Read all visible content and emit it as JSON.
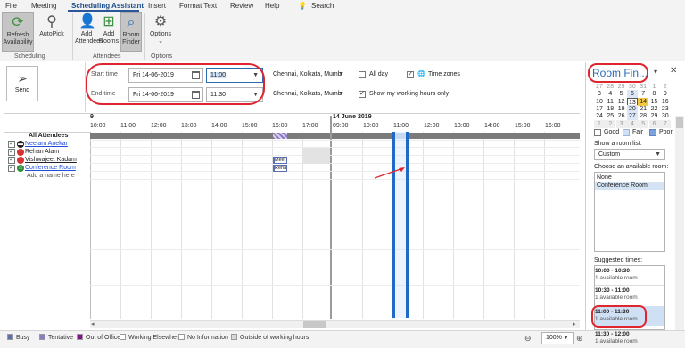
{
  "menu": [
    "File",
    "Meeting",
    "Scheduling Assistant",
    "Insert",
    "Format Text",
    "Review",
    "Help",
    "Search"
  ],
  "ribbon": {
    "refresh": "Refresh Availability",
    "refresh_l1": "Refresh",
    "refresh_l2": "Availability",
    "autopick": "AutoPick",
    "group_scheduling": "Scheduling",
    "add_att_l1": "Add",
    "add_att_l2": "Attendees",
    "add_rooms_l1": "Add",
    "add_rooms_l2": "Rooms",
    "room_finder_l1": "Room",
    "room_finder_l2": "Finder",
    "group_attendees": "Attendees",
    "options": "Options",
    "group_options": "Options"
  },
  "send": "Send",
  "start": {
    "label": "Start time",
    "date": "Fri 14-06-2019",
    "time": "11:00"
  },
  "end": {
    "label": "End time",
    "date": "Fri 14-06-2019",
    "time": "11:30"
  },
  "timezone": "Chennai, Kolkata, Mumb",
  "all_day": "All day",
  "time_zones": "Time zones",
  "show_working": "Show my working hours only",
  "grid": {
    "day1_label": "9",
    "day2_label": "14 June 2019",
    "hours1": [
      "10:00",
      "11:00",
      "12:00",
      "13:00",
      "14:00",
      "15:00",
      "16:00",
      "17:00"
    ],
    "hours2": [
      "09:00",
      "10:00",
      "11:00",
      "12:00",
      "13:00",
      "14:00",
      "15:00",
      "16:00"
    ],
    "all_attendees": "All Attendees",
    "attendees": [
      {
        "name": "Neelam Anekar",
        "link": false
      },
      {
        "name": "Rehan Alam",
        "link": false
      },
      {
        "name": "Vishwajeet Kadam",
        "link": false
      },
      {
        "name": "Conference Room",
        "link": true
      }
    ],
    "add_name": "Add a name here",
    "meet1": "Meet",
    "meet2": "Reha"
  },
  "legend": [
    "Busy",
    "Tentative",
    "Out of Office",
    "Working Elsewhere",
    "No Information",
    "Outside of working hours"
  ],
  "legend_colors": [
    "#5b6fb0",
    "#8e7cc3",
    "#8b0f8b",
    "#ffffff",
    "#ffffff",
    "#d7d7d7"
  ],
  "zoom": "100%",
  "room_finder": {
    "title": "Room Fin...",
    "cal_rows": [
      [
        "27",
        "28",
        "29",
        "30",
        "31",
        "1",
        "2"
      ],
      [
        "3",
        "4",
        "5",
        "6",
        "7",
        "8",
        "9"
      ],
      [
        "10",
        "11",
        "12",
        "13",
        "14",
        "15",
        "16"
      ],
      [
        "17",
        "18",
        "19",
        "20",
        "21",
        "22",
        "23"
      ],
      [
        "24",
        "25",
        "26",
        "27",
        "28",
        "29",
        "30"
      ],
      [
        "1",
        "2",
        "3",
        "4",
        "5",
        "6",
        "7"
      ]
    ],
    "good": "Good",
    "fair": "Fair",
    "poor": "Poor",
    "show_room_list": "Show a room list:",
    "room_list_value": "Custom",
    "choose_room": "Choose an available room:",
    "rooms": [
      "None",
      "Conference Room"
    ],
    "suggested": "Suggested times:",
    "suggestions": [
      {
        "time": "10:00 - 10:30",
        "count": "1 available room"
      },
      {
        "time": "10:30 - 11:00",
        "count": "1 available room"
      },
      {
        "time": "11:00 - 11:30",
        "count": "1 available room"
      },
      {
        "time": "11:30 - 12:00",
        "count": "1 available room"
      }
    ]
  }
}
